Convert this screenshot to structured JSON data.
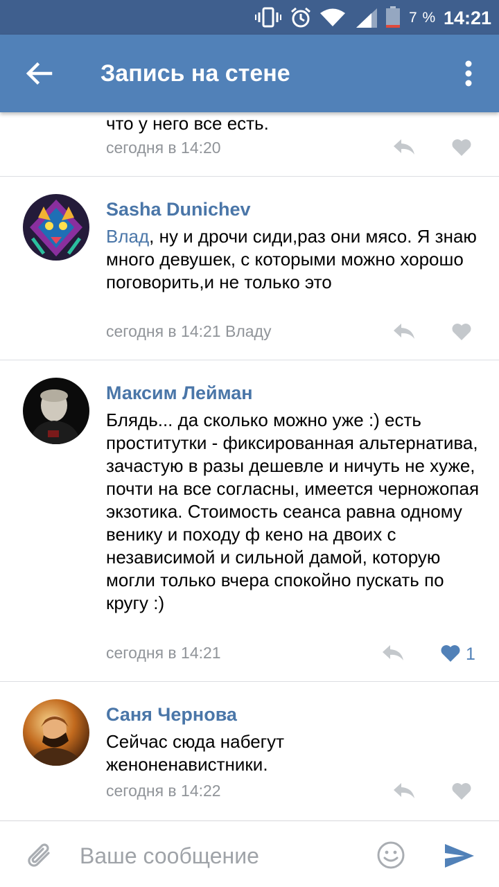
{
  "status_bar": {
    "battery_percent": "7 %",
    "time": "14:21",
    "icons": [
      "vibrate-icon",
      "alarm-icon",
      "wifi-icon",
      "signal-icon",
      "battery-icon"
    ]
  },
  "header": {
    "title": "Запись на стене",
    "back_icon": "arrow-left-icon",
    "menu_icon": "more-vertical-icon"
  },
  "comments": [
    {
      "text": "что у него все есть.",
      "meta": "сегодня в 14:20",
      "liked": false
    },
    {
      "author": "Sasha Dunichev",
      "mention": "Влад",
      "text": ", ну и дрочи сиди,раз они мясо. Я знаю много девушек, с которыми можно хорошо  поговорить,и не только это",
      "meta": "сегодня в 14:21 Владу",
      "liked": false
    },
    {
      "author": "Максим Лейман",
      "text": "Блядь... да сколько можно уже :) есть проститутки - фиксированная альтернатива, зачастую в разы дешевле и ничуть не хуже, почти на все согласны, имеется черножопая экзотика. Стоимость сеанса равна одному венику и походу ф кено на двоих с независимой и сильной дамой, которую могли только вчера спокойно пускать по кругу :)",
      "meta": "сегодня в 14:21",
      "liked": true,
      "like_count": "1"
    },
    {
      "author": "Саня Чернова",
      "text": "Сейчас сюда набегут женоненавистники.",
      "meta": "сегодня в 14:22",
      "liked": false
    }
  ],
  "composer": {
    "placeholder": "Ваше сообщение",
    "value": ""
  },
  "colors": {
    "status_bar": "#3f5f8e",
    "app_bar": "#5181b8",
    "link": "#4a76a8",
    "meta": "#909499",
    "icon_gray": "#c4c8cc"
  }
}
